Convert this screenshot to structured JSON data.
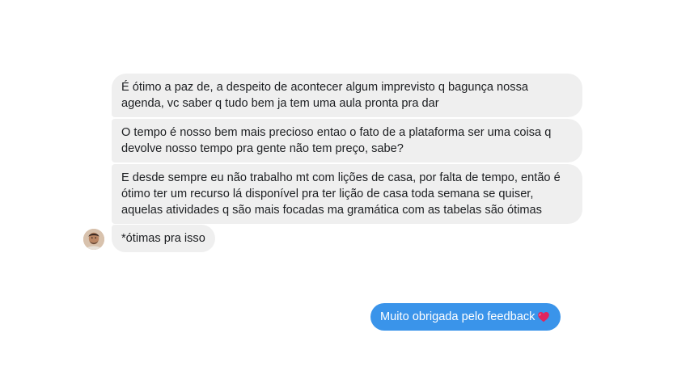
{
  "conversation": {
    "incoming_messages": [
      "É ótimo a paz de, a despeito de acontecer algum imprevisto q bagunça nossa agenda, vc saber q tudo bem ja tem uma aula pronta pra dar",
      "O tempo é nosso bem mais precioso entao  o fato de a plataforma ser uma coisa q devolve nosso tempo pra gente não tem preço, sabe?",
      "E desde sempre eu não trabalho mt com lições de casa, por falta de tempo, então é ótimo ter um recurso lá disponível pra ter lição de casa toda semana se quiser, aquelas atividades q são mais focadas ma gramática com as tabelas são ótimas",
      "*ótimas pra isso"
    ],
    "outgoing_message": {
      "text": "Muito obrigada pelo feedback",
      "emoji": "heart-icon"
    }
  },
  "colors": {
    "incoming_bubble": "#efefef",
    "outgoing_bubble": "#3a94ea",
    "heart": "#e0245e"
  }
}
